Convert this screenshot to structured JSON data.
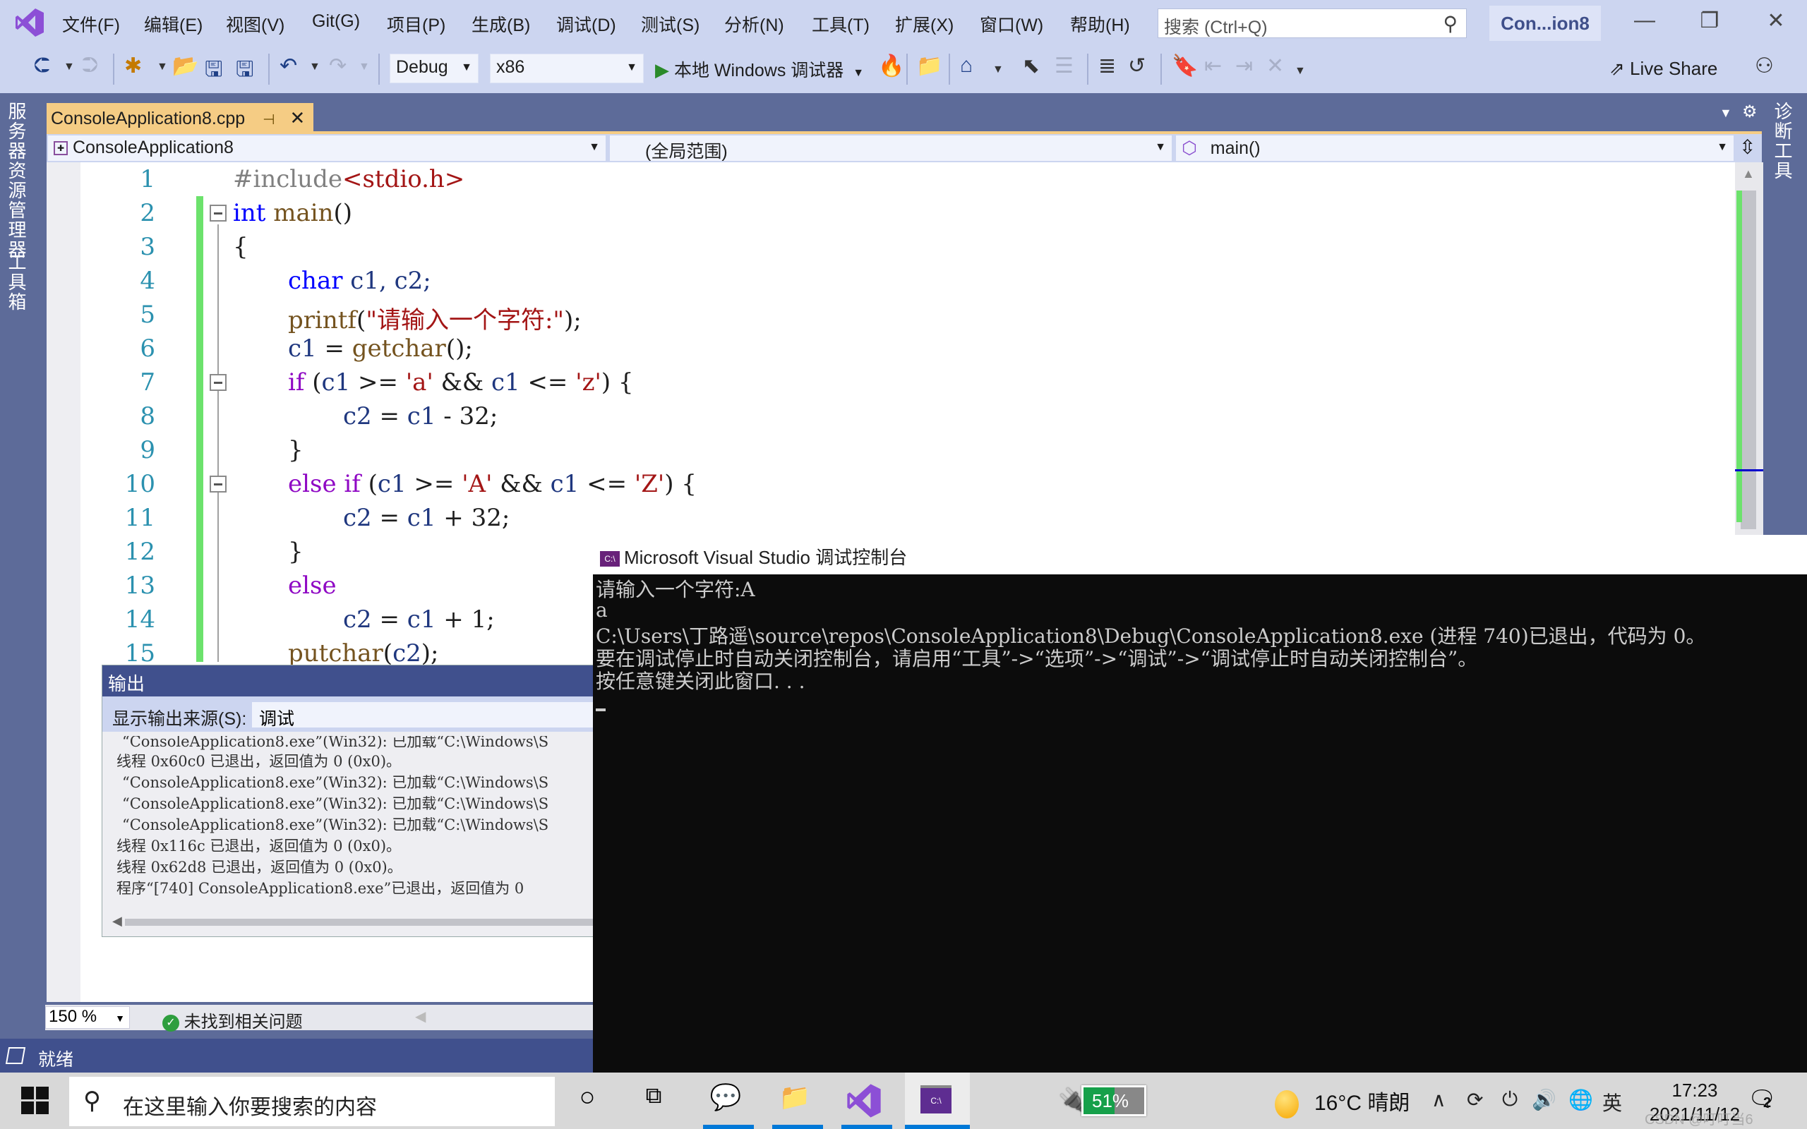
{
  "app": {
    "title_badge": "Con...ion8",
    "menu": [
      "文件(F)",
      "编辑(E)",
      "视图(V)",
      "Git(G)",
      "项目(P)",
      "生成(B)",
      "调试(D)",
      "测试(S)",
      "分析(N)",
      "工具(T)",
      "扩展(X)",
      "窗口(W)",
      "帮助(H)"
    ],
    "search_placeholder": "搜索 (Ctrl+Q)",
    "window_controls": {
      "minimize": "—",
      "restore": "❐",
      "close": "✕"
    }
  },
  "toolbar": {
    "config": "Debug",
    "platform": "x86",
    "run_label": "本地 Windows 调试器",
    "live_share": "Live Share"
  },
  "side_tabs": {
    "left": [
      "服务器资源管理器",
      "工具箱"
    ],
    "right": [
      "诊断工具"
    ]
  },
  "document": {
    "tab_label": "ConsoleApplication8.cpp",
    "nav_project": "ConsoleApplication8",
    "nav_scope": "(全局范围)",
    "nav_member": "main()"
  },
  "code_lines": [
    {
      "n": "1"
    },
    {
      "n": "2"
    },
    {
      "n": "3"
    },
    {
      "n": "4"
    },
    {
      "n": "5"
    },
    {
      "n": "6"
    },
    {
      "n": "7"
    },
    {
      "n": "8"
    },
    {
      "n": "9"
    },
    {
      "n": "10"
    },
    {
      "n": "11"
    },
    {
      "n": "12"
    },
    {
      "n": "13"
    },
    {
      "n": "14"
    },
    {
      "n": "15"
    }
  ],
  "code": {
    "l1": {
      "pp": "#include",
      "hdr": "<stdio.h>"
    },
    "l2": {
      "kw": "int",
      "fn": "main",
      "rest": "()"
    },
    "l3": "{",
    "l4": {
      "kw": "char",
      "rest": " c1, c2;"
    },
    "l5": {
      "fn": "printf",
      "open": "(",
      "str": "\"请输入一个字符:\"",
      "close": ");"
    },
    "l6": {
      "v": "c1",
      "eq": " = ",
      "fn": "getchar",
      "rest": "();"
    },
    "l7": {
      "kw": "if",
      "a": " (",
      "v1": "c1",
      "b": " >= ",
      "s1": "'a'",
      "c": " && ",
      "v2": "c1",
      "d": " <= ",
      "s2": "'z'",
      "e": ") {"
    },
    "l8": {
      "v1": "c2",
      "mid": " = ",
      "v2": "c1",
      "rest": " - 32;"
    },
    "l9": "}",
    "l10": {
      "kw": "else if",
      "a": " (",
      "v1": "c1",
      "b": " >= ",
      "s1": "'A'",
      "c": " && ",
      "v2": "c1",
      "d": " <= ",
      "s2": "'Z'",
      "e": ") {"
    },
    "l11": {
      "v1": "c2",
      "mid": " = ",
      "v2": "c1",
      "rest": " + 32;"
    },
    "l12": "}",
    "l13": {
      "kw": "else"
    },
    "l14": {
      "v1": "c2",
      "mid": " = ",
      "v2": "c1",
      "rest": " + 1;"
    },
    "l15": {
      "fn": "putchar",
      "a": "(",
      "v": "c2",
      "rest": ");"
    }
  },
  "editor_status": {
    "zoom": "150 %",
    "issues": "未找到相关问题"
  },
  "statusbar": {
    "text": "就绪"
  },
  "output_panel": {
    "title": "输出",
    "source_label": "显示输出来源(S):",
    "source_value": "调试",
    "lines": [
      "“ConsoleApplication8.exe”(Win32): 已加载“C:\\Windows\\S",
      "线程 0x60c0 已退出，返回值为 0 (0x0)。",
      "“ConsoleApplication8.exe”(Win32): 已加载“C:\\Windows\\S",
      "“ConsoleApplication8.exe”(Win32): 已加载“C:\\Windows\\S",
      "“ConsoleApplication8.exe”(Win32): 已加载“C:\\Windows\\S",
      "线程 0x116c 已退出，返回值为 0 (0x0)。",
      "线程 0x62d8 已退出，返回值为 0 (0x0)。",
      "程序“[740] ConsoleApplication8.exe”已退出，返回值为 0"
    ]
  },
  "console": {
    "title": "Microsoft Visual Studio 调试控制台",
    "lines": [
      "请输入一个字符:A",
      "a",
      "C:\\Users\\丁路遥\\source\\repos\\ConsoleApplication8\\Debug\\ConsoleApplication8.exe (进程 740)已退出，代码为 0。",
      "要在调试停止时自动关闭控制台，请启用“工具”->“选项”->“调试”->“调试停止时自动关闭控制台”。",
      "按任意键关闭此窗口. . ."
    ]
  },
  "taskbar": {
    "search_placeholder": "在这里输入你要搜索的内容",
    "battery": "51%",
    "weather": "16°C 晴朗",
    "ime": "英",
    "time": "17:23",
    "date": "2021/11/12",
    "notifications": "2",
    "watermark": "CSDN @叮叮当6"
  }
}
